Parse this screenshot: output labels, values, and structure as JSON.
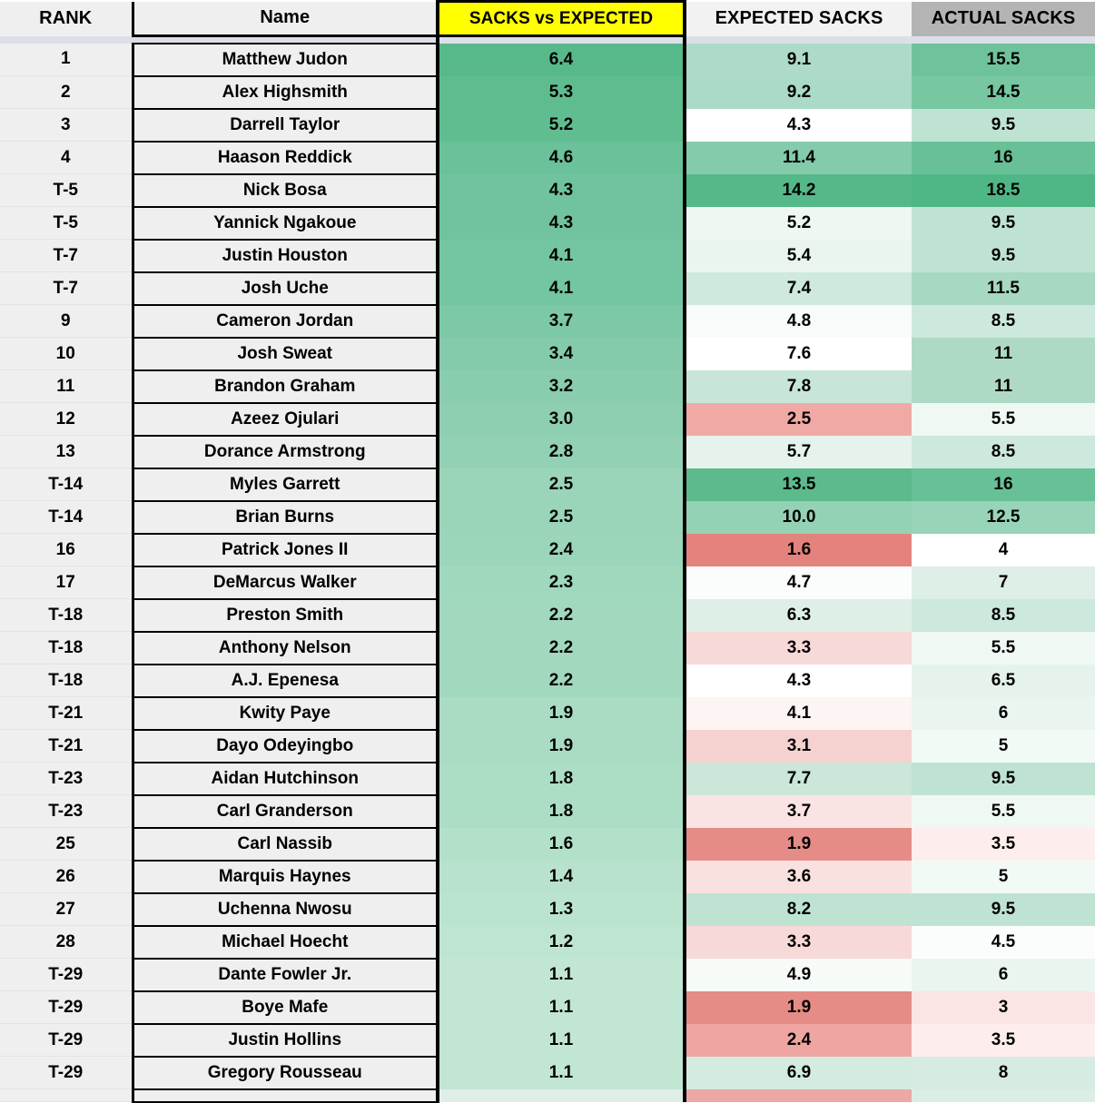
{
  "table": {
    "columns": [
      {
        "key": "rank",
        "label": "RANK"
      },
      {
        "key": "name",
        "label": "Name"
      },
      {
        "key": "sve",
        "label": "SACKS vs EXPECTED"
      },
      {
        "key": "exp",
        "label": "EXPECTED SACKS"
      },
      {
        "key": "act",
        "label": "ACTUAL SACKS"
      }
    ],
    "header_colors": {
      "rank_bg": "#efefef",
      "name_bg": "#efefef",
      "sve_bg": "#ffff00",
      "exp_bg": "#f2f2f2",
      "act_bg": "#b4b4b4",
      "strip_bg": "#dcdfe8"
    },
    "scale_colors": {
      "green_dark": "#57b98a",
      "green_light": "#e0eee7",
      "red_dark": "#e28883",
      "red_light": "#fbeceb",
      "white": "#ffffff"
    },
    "rows": [
      {
        "rank": "1",
        "name": "Matthew Judon",
        "sve": "6.4",
        "exp": "9.1",
        "act": "15.5",
        "sve_bg": "#57b98a",
        "exp_bg": "#addbc7",
        "act_bg": "#6fc39b"
      },
      {
        "rank": "2",
        "name": "Alex Highsmith",
        "sve": "5.3",
        "exp": "9.2",
        "act": "14.5",
        "sve_bg": "#5fbc8f",
        "exp_bg": "#abdac6",
        "act_bg": "#77c7a1"
      },
      {
        "rank": "3",
        "name": "Darrell Taylor",
        "sve": "5.2",
        "exp": "4.3",
        "act": "9.5",
        "sve_bg": "#60bd90",
        "exp_bg": "#ffffff",
        "act_bg": "#bfe3d3"
      },
      {
        "rank": "4",
        "name": "Haason Reddick",
        "sve": "4.6",
        "exp": "11.4",
        "act": "16",
        "sve_bg": "#6ac19a",
        "exp_bg": "#84cbab",
        "act_bg": "#67c096"
      },
      {
        "rank": "T-5",
        "name": "Nick Bosa",
        "sve": "4.3",
        "exp": "14.2",
        "act": "18.5",
        "sve_bg": "#70c39e",
        "exp_bg": "#55b889",
        "act_bg": "#4fb685"
      },
      {
        "rank": "T-5",
        "name": "Yannick Ngakoue",
        "sve": "4.3",
        "exp": "5.2",
        "act": "9.5",
        "sve_bg": "#70c39e",
        "exp_bg": "#eef7f2",
        "act_bg": "#bfe3d3"
      },
      {
        "rank": "T-7",
        "name": "Justin Houston",
        "sve": "4.1",
        "exp": "5.4",
        "act": "9.5",
        "sve_bg": "#74c5a1",
        "exp_bg": "#eaf5f0",
        "act_bg": "#bfe3d3"
      },
      {
        "rank": "T-7",
        "name": "Josh Uche",
        "sve": "4.1",
        "exp": "7.4",
        "act": "11.5",
        "sve_bg": "#74c5a1",
        "exp_bg": "#cfe9dd",
        "act_bg": "#a6d8c2"
      },
      {
        "rank": "9",
        "name": "Cameron Jordan",
        "sve": "3.7",
        "exp": "4.8",
        "act": "8.5",
        "sve_bg": "#7dc9a7",
        "exp_bg": "#f7fbf9",
        "act_bg": "#cde8dd"
      },
      {
        "rank": "10",
        "name": "Josh Sweat",
        "sve": "3.4",
        "exp": "7.6",
        "act": "11",
        "sve_bg": "#84cbab",
        "exp_bg": "#ccе8db",
        "act_bg": "#aedac5"
      },
      {
        "rank": "11",
        "name": "Brandon Graham",
        "sve": "3.2",
        "exp": "7.8",
        "act": "11",
        "sve_bg": "#89cdae",
        "exp_bg": "#c8e6d8",
        "act_bg": "#aedac5"
      },
      {
        "rank": "12",
        "name": "Azeez Ojulari",
        "sve": "3.0",
        "exp": "2.5",
        "act": "5.5",
        "sve_bg": "#8ecfb1",
        "exp_bg": "#f0a9a5",
        "act_bg": "#eff8f3"
      },
      {
        "rank": "13",
        "name": "Dorance Armstrong",
        "sve": "2.8",
        "exp": "5.7",
        "act": "8.5",
        "sve_bg": "#93d1b5",
        "exp_bg": "#e5f3ec",
        "act_bg": "#cde8dd"
      },
      {
        "rank": "T-14",
        "name": "Myles Garrett",
        "sve": "2.5",
        "exp": "13.5",
        "act": "16",
        "sve_bg": "#9ad5b9",
        "exp_bg": "#5cba8d",
        "act_bg": "#67c096"
      },
      {
        "rank": "T-14",
        "name": "Brian Burns",
        "sve": "2.5",
        "exp": "10.0",
        "act": "12.5",
        "sve_bg": "#9ad5b9",
        "exp_bg": "#94d2b6",
        "act_bg": "#98d4b8"
      },
      {
        "rank": "16",
        "name": "Patrick Jones II",
        "sve": "2.4",
        "exp": "1.6",
        "act": "4",
        "sve_bg": "#9cd6ba",
        "exp_bg": "#e4837e",
        "act_bg": "#ffffff"
      },
      {
        "rank": "17",
        "name": "DeMarcus Walker",
        "sve": "2.3",
        "exp": "4.7",
        "act": "7",
        "sve_bg": "#9fd8bc",
        "exp_bg": "#fafdfb",
        "act_bg": "#ddefe7"
      },
      {
        "rank": "T-18",
        "name": "Preston Smith",
        "sve": "2.2",
        "exp": "6.3",
        "act": "8.5",
        "sve_bg": "#a2d9be",
        "exp_bg": "#ddefe7",
        "act_bg": "#cde8dd"
      },
      {
        "rank": "T-18",
        "name": "Anthony Nelson",
        "sve": "2.2",
        "exp": "3.3",
        "act": "5.5",
        "sve_bg": "#a2d9be",
        "exp_bg": "#f7d9d8",
        "act_bg": "#eff8f3"
      },
      {
        "rank": "T-18",
        "name": "A.J. Epenesa",
        "sve": "2.2",
        "exp": "4.3",
        "act": "6.5",
        "sve_bg": "#a2d9be",
        "exp_bg": "#ffffff",
        "act_bg": "#e5f3ec"
      },
      {
        "rank": "T-21",
        "name": "Kwity Paye",
        "sve": "1.9",
        "exp": "4.1",
        "act": "6",
        "sve_bg": "#a9dcc3",
        "exp_bg": "#fdf4f4",
        "act_bg": "#eaf5f0"
      },
      {
        "rank": "T-21",
        "name": "Dayo Odeyingbo",
        "sve": "1.9",
        "exp": "3.1",
        "act": "5",
        "sve_bg": "#a9dcc3",
        "exp_bg": "#f5d2d0",
        "act_bg": "#f2faf6"
      },
      {
        "rank": "T-23",
        "name": "Aidan Hutchinson",
        "sve": "1.8",
        "exp": "7.7",
        "act": "9.5",
        "sve_bg": "#acddc5",
        "exp_bg": "#cae7da",
        "act_bg": "#bfe3d3"
      },
      {
        "rank": "T-23",
        "name": "Carl Granderson",
        "sve": "1.8",
        "exp": "3.7",
        "act": "5.5",
        "sve_bg": "#acddc5",
        "exp_bg": "#fae4e3",
        "act_bg": "#eff8f3"
      },
      {
        "rank": "25",
        "name": "Carl Nassib",
        "sve": "1.6",
        "exp": "1.9",
        "act": "3.5",
        "sve_bg": "#b2e0c9",
        "exp_bg": "#e58c87",
        "act_bg": "#fdeeed"
      },
      {
        "rank": "26",
        "name": "Marquis Haynes",
        "sve": "1.4",
        "exp": "3.6",
        "act": "5",
        "sve_bg": "#b8e2ce",
        "exp_bg": "#f9e1e0",
        "act_bg": "#f2faf6"
      },
      {
        "rank": "27",
        "name": "Uchenna Nwosu",
        "sve": "1.3",
        "exp": "8.2",
        "act": "9.5",
        "sve_bg": "#bbe4d0",
        "exp_bg": "#bfe3d3",
        "act_bg": "#bfe3d3"
      },
      {
        "rank": "28",
        "name": "Michael Hoecht",
        "sve": "1.2",
        "exp": "3.3",
        "act": "4.5",
        "sve_bg": "#bee5d2",
        "exp_bg": "#f7d9d8",
        "act_bg": "#fbfdfc"
      },
      {
        "rank": "T-29",
        "name": "Dante Fowler Jr.",
        "sve": "1.1",
        "exp": "4.9",
        "act": "6",
        "sve_bg": "#c1e6d4",
        "exp_bg": "#f6fbf8",
        "act_bg": "#eaf5f0"
      },
      {
        "rank": "T-29",
        "name": "Boye Mafe",
        "sve": "1.1",
        "exp": "1.9",
        "act": "3",
        "sve_bg": "#c1e6d4",
        "exp_bg": "#e58c87",
        "act_bg": "#fae5e4"
      },
      {
        "rank": "T-29",
        "name": "Justin Hollins",
        "sve": "1.1",
        "exp": "2.4",
        "act": "3.5",
        "sve_bg": "#c1e6d4",
        "exp_bg": "#efa6a2",
        "act_bg": "#fdeeed"
      },
      {
        "rank": "T-29",
        "name": "Gregory Rousseau",
        "sve": "1.1",
        "exp": "6.9",
        "act": "8",
        "sve_bg": "#c1e6d4",
        "exp_bg": "#d4ebe0",
        "act_bg": "#d6ece2"
      }
    ],
    "partial_row": {
      "sve_bg": "#dfeee6",
      "exp_bg": "#eca8a4",
      "act_bg": "#dbeee4"
    }
  },
  "chart_data": {
    "type": "table",
    "title": "SACKS vs EXPECTED leaderboard",
    "columns": [
      "RANK",
      "Name",
      "SACKS vs EXPECTED",
      "EXPECTED SACKS",
      "ACTUAL SACKS"
    ],
    "rows": [
      [
        "1",
        "Matthew Judon",
        6.4,
        9.1,
        15.5
      ],
      [
        "2",
        "Alex Highsmith",
        5.3,
        9.2,
        14.5
      ],
      [
        "3",
        "Darrell Taylor",
        5.2,
        4.3,
        9.5
      ],
      [
        "4",
        "Haason Reddick",
        4.6,
        11.4,
        16
      ],
      [
        "T-5",
        "Nick Bosa",
        4.3,
        14.2,
        18.5
      ],
      [
        "T-5",
        "Yannick Ngakoue",
        4.3,
        5.2,
        9.5
      ],
      [
        "T-7",
        "Justin Houston",
        4.1,
        5.4,
        9.5
      ],
      [
        "T-7",
        "Josh Uche",
        4.1,
        7.4,
        11.5
      ],
      [
        "9",
        "Cameron Jordan",
        3.7,
        4.8,
        8.5
      ],
      [
        "10",
        "Josh Sweat",
        3.4,
        7.6,
        11
      ],
      [
        "11",
        "Brandon Graham",
        3.2,
        7.8,
        11
      ],
      [
        "12",
        "Azeez Ojulari",
        3.0,
        2.5,
        5.5
      ],
      [
        "13",
        "Dorance Armstrong",
        2.8,
        5.7,
        8.5
      ],
      [
        "T-14",
        "Myles Garrett",
        2.5,
        13.5,
        16
      ],
      [
        "T-14",
        "Brian Burns",
        2.5,
        10.0,
        12.5
      ],
      [
        "16",
        "Patrick Jones II",
        2.4,
        1.6,
        4
      ],
      [
        "17",
        "DeMarcus Walker",
        2.3,
        4.7,
        7
      ],
      [
        "T-18",
        "Preston Smith",
        2.2,
        6.3,
        8.5
      ],
      [
        "T-18",
        "Anthony Nelson",
        2.2,
        3.3,
        5.5
      ],
      [
        "T-18",
        "A.J. Epenesa",
        2.2,
        4.3,
        6.5
      ],
      [
        "T-21",
        "Kwity Paye",
        1.9,
        4.1,
        6
      ],
      [
        "T-21",
        "Dayo Odeyingbo",
        1.9,
        3.1,
        5
      ],
      [
        "T-23",
        "Aidan Hutchinson",
        1.8,
        7.7,
        9.5
      ],
      [
        "T-23",
        "Carl Granderson",
        1.8,
        3.7,
        5.5
      ],
      [
        "25",
        "Carl Nassib",
        1.6,
        1.9,
        3.5
      ],
      [
        "26",
        "Marquis Haynes",
        1.4,
        3.6,
        5
      ],
      [
        "27",
        "Uchenna Nwosu",
        1.3,
        8.2,
        9.5
      ],
      [
        "28",
        "Michael Hoecht",
        1.2,
        3.3,
        4.5
      ],
      [
        "T-29",
        "Dante Fowler Jr.",
        1.1,
        4.9,
        6
      ],
      [
        "T-29",
        "Boye Mafe",
        1.1,
        1.9,
        3
      ],
      [
        "T-29",
        "Justin Hollins",
        1.1,
        2.4,
        3.5
      ],
      [
        "T-29",
        "Gregory Rousseau",
        1.1,
        6.9,
        8
      ]
    ]
  }
}
